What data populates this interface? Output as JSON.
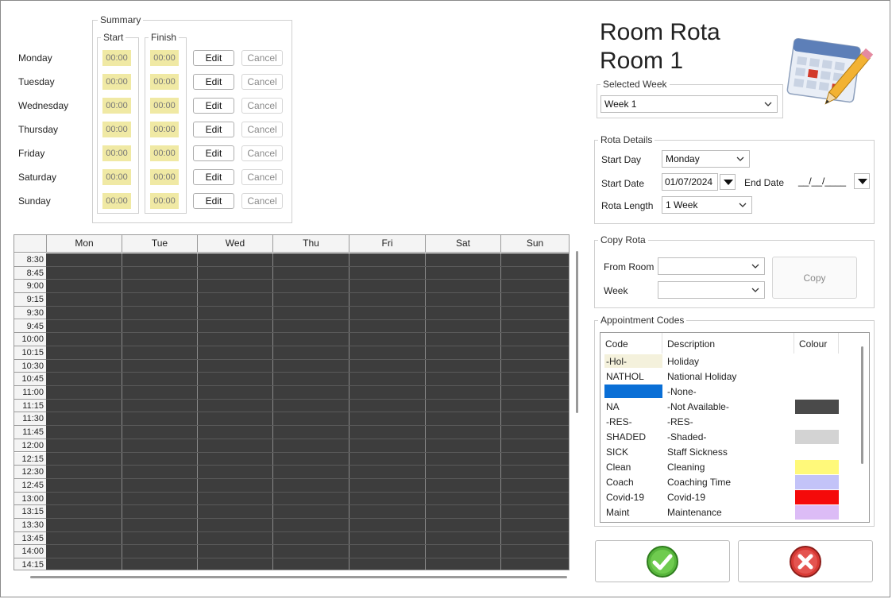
{
  "summary": {
    "title": "Summary",
    "start_label": "Start",
    "finish_label": "Finish",
    "days": [
      {
        "day": "Monday",
        "start": "00:00",
        "finish": "00:00",
        "edit": "Edit",
        "cancel": "Cancel"
      },
      {
        "day": "Tuesday",
        "start": "00:00",
        "finish": "00:00",
        "edit": "Edit",
        "cancel": "Cancel"
      },
      {
        "day": "Wednesday",
        "start": "00:00",
        "finish": "00:00",
        "edit": "Edit",
        "cancel": "Cancel"
      },
      {
        "day": "Thursday",
        "start": "00:00",
        "finish": "00:00",
        "edit": "Edit",
        "cancel": "Cancel"
      },
      {
        "day": "Friday",
        "start": "00:00",
        "finish": "00:00",
        "edit": "Edit",
        "cancel": "Cancel"
      },
      {
        "day": "Saturday",
        "start": "00:00",
        "finish": "00:00",
        "edit": "Edit",
        "cancel": "Cancel"
      },
      {
        "day": "Sunday",
        "start": "00:00",
        "finish": "00:00",
        "edit": "Edit",
        "cancel": "Cancel"
      }
    ]
  },
  "grid": {
    "columns": [
      "Mon",
      "Tue",
      "Wed",
      "Thu",
      "Fri",
      "Sat",
      "Sun"
    ],
    "times": [
      "8:30",
      "8:45",
      "9:00",
      "9:15",
      "9:30",
      "9:45",
      "10:00",
      "10:15",
      "10:30",
      "10:45",
      "11:00",
      "11:15",
      "11:30",
      "11:45",
      "12:00",
      "12:15",
      "12:30",
      "12:45",
      "13:00",
      "13:15",
      "13:30",
      "13:45",
      "14:00",
      "14:15"
    ]
  },
  "header": {
    "title_line1": "Room Rota",
    "title_line2": "Room 1",
    "icon": "calendar-pencil-icon"
  },
  "selected_week": {
    "title": "Selected Week",
    "value": "Week 1"
  },
  "rota_details": {
    "title": "Rota Details",
    "start_day_label": "Start Day",
    "start_day_value": "Monday",
    "start_date_label": "Start Date",
    "start_date_value": "01/07/2024",
    "end_date_label": "End Date",
    "end_date_value": "__/__/____",
    "rota_length_label": "Rota Length",
    "rota_length_value": "1 Week"
  },
  "copy_rota": {
    "title": "Copy Rota",
    "from_room_label": "From Room",
    "from_room_value": "",
    "week_label": "Week",
    "week_value": "",
    "copy_label": "Copy"
  },
  "appointment_codes": {
    "title": "Appointment Codes",
    "headers": {
      "code": "Code",
      "description": "Description",
      "colour": "Colour"
    },
    "rows": [
      {
        "code": "-Hol-",
        "description": "Holiday",
        "code_bg": "#f4f1dc",
        "colour": ""
      },
      {
        "code": "NATHOL",
        "description": "National Holiday",
        "code_bg": "",
        "colour": ""
      },
      {
        "code": "",
        "description": "-None-",
        "code_bg": "#0a6fd6",
        "colour": ""
      },
      {
        "code": "NA",
        "description": "-Not Available-",
        "code_bg": "",
        "colour": "#4a4a4a"
      },
      {
        "code": "-RES-",
        "description": "-RES-",
        "code_bg": "",
        "colour": ""
      },
      {
        "code": "SHADED",
        "description": "-Shaded-",
        "code_bg": "",
        "colour": "#d3d3d3"
      },
      {
        "code": "SICK",
        "description": "Staff Sickness",
        "code_bg": "",
        "colour": ""
      },
      {
        "code": "Clean",
        "description": "Cleaning",
        "code_bg": "",
        "colour": "#fff97a"
      },
      {
        "code": "Coach",
        "description": "Coaching Time",
        "code_bg": "",
        "colour": "#c3c3f8"
      },
      {
        "code": "Covid-19",
        "description": "Covid-19",
        "code_bg": "",
        "colour": "#f50a0a"
      },
      {
        "code": "Maint",
        "description": "Maintenance",
        "code_bg": "",
        "colour": "#dcbcf6"
      }
    ]
  },
  "actions": {
    "ok_icon": "green-check-icon",
    "cancel_icon": "red-x-icon"
  }
}
